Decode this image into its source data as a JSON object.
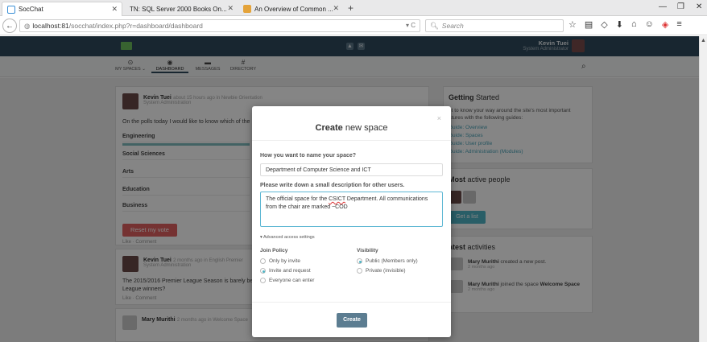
{
  "browser": {
    "tabs": [
      {
        "label": "SocChat",
        "active": true
      },
      {
        "label": "TN: SQL Server 2000 Books On...",
        "active": false
      },
      {
        "label": "An Overview of Common ...",
        "active": false
      }
    ],
    "new_tab": "+",
    "url_host": "localhost:81",
    "url_path": "/socchat/index.php?r=dashboard/dashboard",
    "search_placeholder": "Search"
  },
  "header": {
    "user_name": "Kevin Tuei",
    "user_role": "System Administrator"
  },
  "subnav": {
    "items": [
      {
        "label": "MY SPACES ⌄",
        "icon": "spaces-icon"
      },
      {
        "label": "DASHBOARD",
        "icon": "dashboard-icon",
        "active": true
      },
      {
        "label": "MESSAGES",
        "icon": "messages-icon"
      },
      {
        "label": "DIRECTORY",
        "icon": "directory-icon"
      }
    ]
  },
  "feed": {
    "post1": {
      "author": "Kevin Tuei",
      "meta": "about 15 hours ago in Newbie Orientation",
      "role": "System Administration",
      "text": "On the polls today I would like to know which of the",
      "options": [
        "Engineering",
        "Social Sciences",
        "Arts",
        "Education",
        "Business"
      ],
      "reset_label": "Reset my vote",
      "actions": "Like · Comment"
    },
    "post2": {
      "author": "Kevin Tuei",
      "meta": "2 months ago in English Premier",
      "role": "System Administration",
      "text": "The 2015/2016 Premier League Season is barely be",
      "text2": "League winners?",
      "actions": "Like · Comment"
    },
    "post3": {
      "author": "Mary Murithi",
      "meta": "2 months ago in Welcome Space"
    }
  },
  "sidebar": {
    "getting_started": {
      "title_bold": "Getting",
      "title_rest": " Started",
      "intro1": "et to know your way around the site's most important",
      "intro2": "atures with the following guides:",
      "guides": [
        "Guide: Overview",
        "Guide: Spaces",
        "Guide: User profile",
        "Guide: Administration (Modules)"
      ]
    },
    "active_people": {
      "title_bold": "Most",
      "title_rest": " active people",
      "button": "Get a list"
    },
    "latest": {
      "title_bold": "atest",
      "title_rest": " activities",
      "items": [
        {
          "name": "Mary Murithi",
          "text": " created a new post.",
          "time": "2 months ago"
        },
        {
          "name": "Mary Murithi",
          "text": " joined the space ",
          "target": "Welcome Space",
          "time": "2 months ago"
        }
      ]
    }
  },
  "modal": {
    "title_bold": "Create",
    "title_rest": " new space",
    "name_label": "How you want to name your space?",
    "name_value": "Department of Computer Science and ICT",
    "desc_label": "Please write down a small description for other users.",
    "desc_part1": "The official space for the ",
    "desc_underlined": "CSICT",
    "desc_part2": " Department. All communications from the chair are marked ~COD",
    "advanced": "▾ Advanced access settings",
    "join_policy": {
      "title": "Join Policy",
      "options": [
        "Only by invite",
        "Invite and request",
        "Everyone can enter"
      ],
      "selected": "Invite and request"
    },
    "visibility": {
      "title": "Visibility",
      "options": [
        "Public (Members only)",
        "Private (invisible)"
      ],
      "selected": "Public (Members only)"
    },
    "create_label": "Create",
    "close": "×"
  },
  "colors": {
    "header_bg": "#2f4a5c",
    "accent": "#4fb4c5",
    "danger": "#e06161",
    "create_btn": "#5c7d91"
  }
}
